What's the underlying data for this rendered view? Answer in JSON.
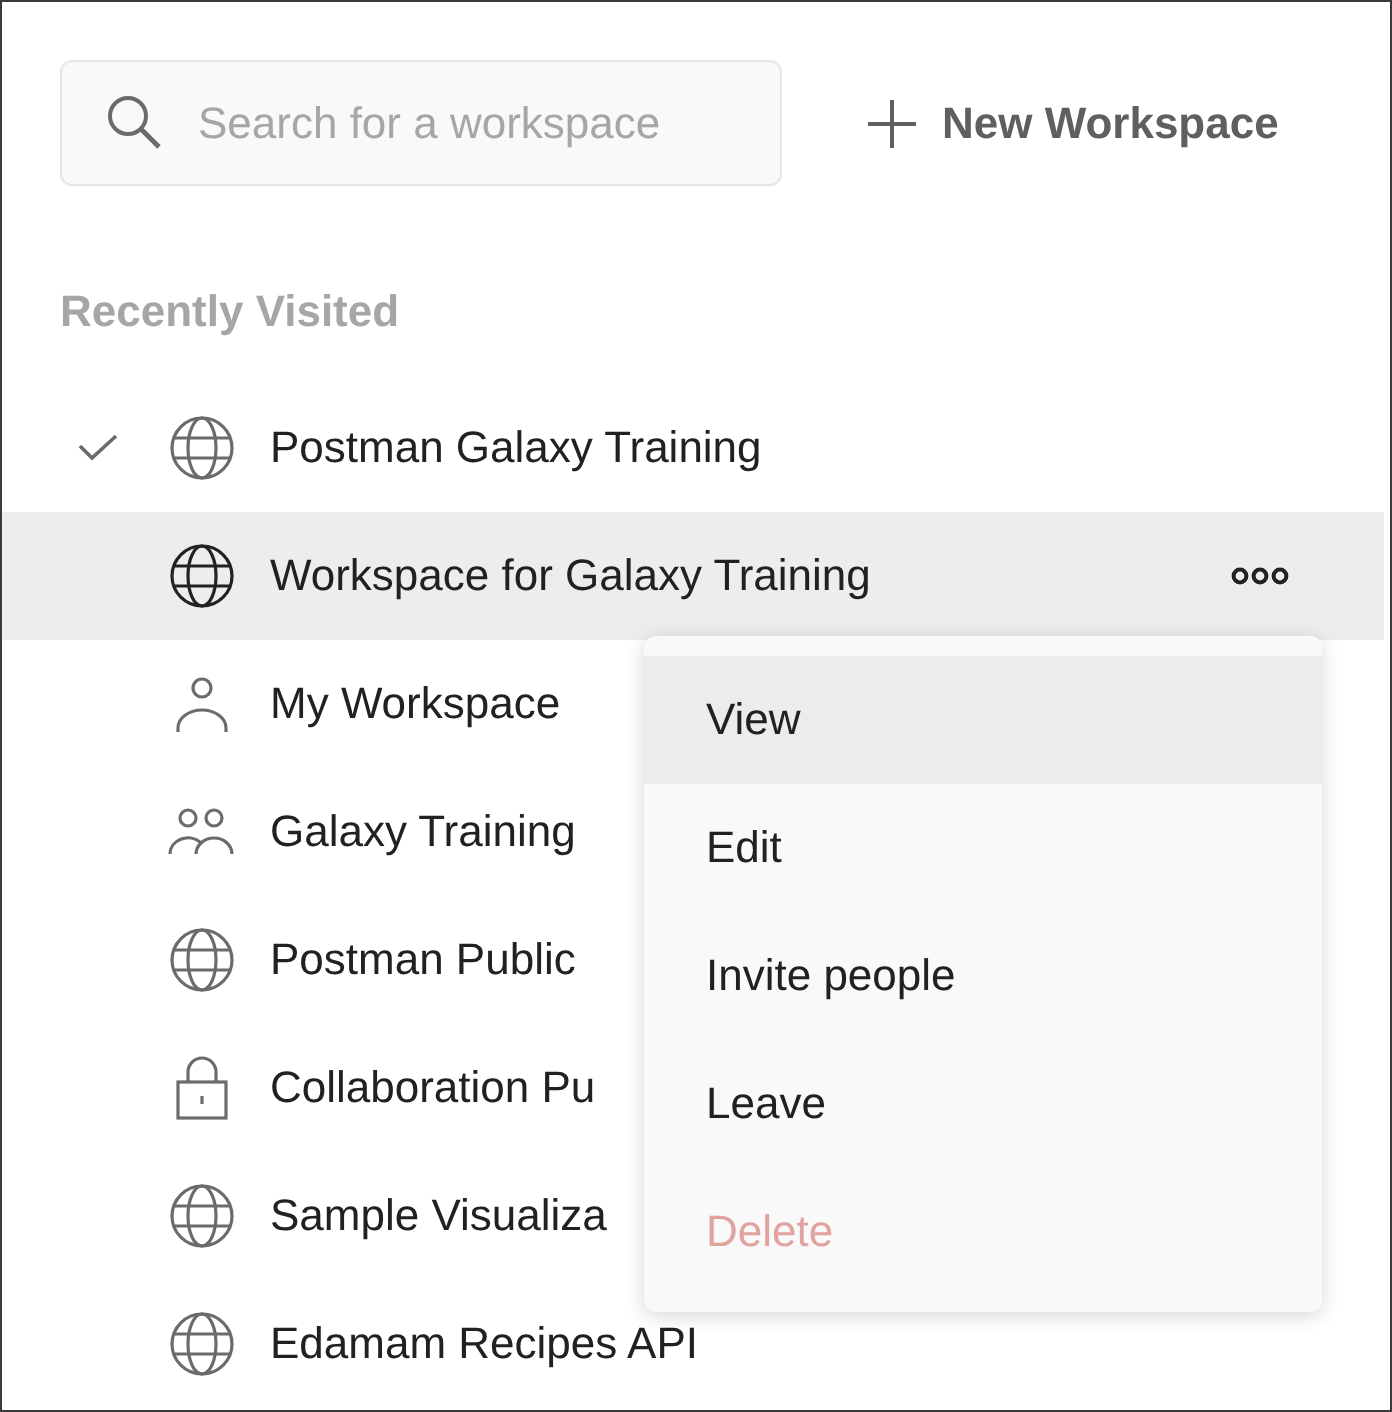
{
  "search": {
    "placeholder": "Search for a workspace"
  },
  "new_workspace_button": {
    "label": "New Workspace"
  },
  "section_title": "Recently Visited",
  "workspaces": [
    {
      "name": "Postman Galaxy Training",
      "kind": "globe",
      "checked": true,
      "selected": false
    },
    {
      "name": "Workspace for Galaxy Training",
      "kind": "globe",
      "checked": false,
      "selected": true
    },
    {
      "name": "My Workspace",
      "kind": "person",
      "checked": false,
      "selected": false
    },
    {
      "name": "Galaxy Training",
      "kind": "team",
      "checked": false,
      "selected": false
    },
    {
      "name": "Postman Public",
      "kind": "globe",
      "checked": false,
      "selected": false
    },
    {
      "name": "Collaboration Pu",
      "kind": "lock",
      "checked": false,
      "selected": false
    },
    {
      "name": "Sample Visualiza",
      "kind": "globe",
      "checked": false,
      "selected": false
    },
    {
      "name": "Edamam Recipes API",
      "kind": "globe",
      "checked": false,
      "selected": false
    }
  ],
  "context_menu": {
    "items": [
      {
        "label": "View",
        "selected": true,
        "disabled": false
      },
      {
        "label": "Edit",
        "selected": false,
        "disabled": false
      },
      {
        "label": "Invite people",
        "selected": false,
        "disabled": false
      },
      {
        "label": "Leave",
        "selected": false,
        "disabled": false
      },
      {
        "label": "Delete",
        "selected": false,
        "disabled": true
      }
    ]
  }
}
